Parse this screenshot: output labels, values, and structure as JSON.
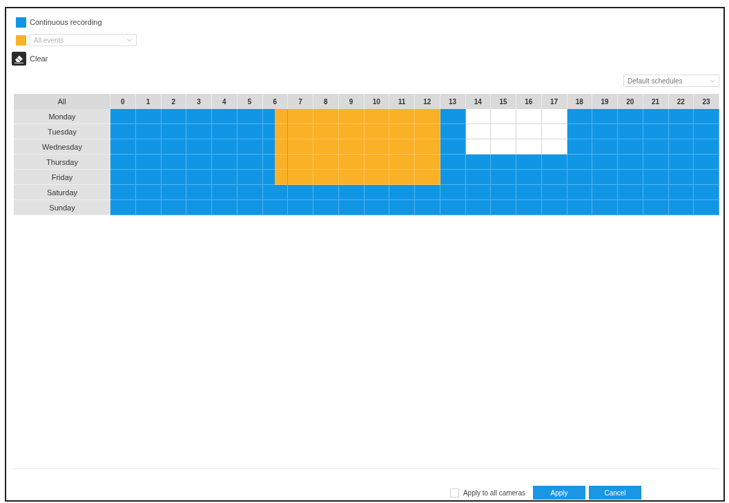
{
  "legend": [
    {
      "kind": "continuous",
      "label": "Continuous recording",
      "color": "#1196e6"
    },
    {
      "kind": "event",
      "color": "#fbb126",
      "dropdown": {
        "value": "All events",
        "disabled": true
      }
    }
  ],
  "clear_button": {
    "label": "Clear"
  },
  "schedule_select": {
    "value": "Default schedules"
  },
  "schedule": {
    "corner": "All",
    "hours": [
      "0",
      "1",
      "2",
      "3",
      "4",
      "5",
      "6",
      "7",
      "8",
      "9",
      "10",
      "11",
      "12",
      "13",
      "14",
      "15",
      "16",
      "17",
      "18",
      "19",
      "20",
      "21",
      "22",
      "23"
    ],
    "rows": [
      {
        "day": "Monday",
        "slots": [
          {
            "kind": "continuous"
          },
          {
            "kind": "continuous"
          },
          {
            "kind": "continuous"
          },
          {
            "kind": "continuous"
          },
          {
            "kind": "continuous"
          },
          {
            "kind": "continuous"
          },
          {
            "kind": "continuous"
          },
          {
            "kind": "continuous"
          },
          {
            "kind": "continuous"
          },
          {
            "kind": "continuous"
          },
          {
            "kind": "continuous"
          },
          {
            "kind": "continuous"
          },
          {
            "kind": "continuous"
          },
          {
            "kind": "event"
          },
          {
            "kind": "event"
          },
          {
            "kind": "event"
          },
          {
            "kind": "event"
          },
          {
            "kind": "event"
          },
          {
            "kind": "event"
          },
          {
            "kind": "event"
          },
          {
            "kind": "event"
          },
          {
            "kind": "event"
          },
          {
            "kind": "event"
          },
          {
            "kind": "event"
          },
          {
            "kind": "event"
          },
          {
            "kind": "event"
          },
          {
            "kind": "continuous"
          },
          {
            "kind": "continuous"
          },
          {
            "kind": "off"
          },
          {
            "kind": "off"
          },
          {
            "kind": "off"
          },
          {
            "kind": "off"
          },
          {
            "kind": "off"
          },
          {
            "kind": "off"
          },
          {
            "kind": "off"
          },
          {
            "kind": "off"
          },
          {
            "kind": "continuous"
          },
          {
            "kind": "continuous"
          },
          {
            "kind": "continuous"
          },
          {
            "kind": "continuous"
          },
          {
            "kind": "continuous"
          },
          {
            "kind": "continuous"
          },
          {
            "kind": "continuous"
          },
          {
            "kind": "continuous"
          },
          {
            "kind": "continuous"
          },
          {
            "kind": "continuous"
          },
          {
            "kind": "continuous"
          },
          {
            "kind": "continuous"
          }
        ]
      },
      {
        "day": "Tuesday",
        "slots": [
          {
            "kind": "continuous"
          },
          {
            "kind": "continuous"
          },
          {
            "kind": "continuous"
          },
          {
            "kind": "continuous"
          },
          {
            "kind": "continuous"
          },
          {
            "kind": "continuous"
          },
          {
            "kind": "continuous"
          },
          {
            "kind": "continuous"
          },
          {
            "kind": "continuous"
          },
          {
            "kind": "continuous"
          },
          {
            "kind": "continuous"
          },
          {
            "kind": "continuous"
          },
          {
            "kind": "continuous"
          },
          {
            "kind": "event"
          },
          {
            "kind": "event"
          },
          {
            "kind": "event"
          },
          {
            "kind": "event"
          },
          {
            "kind": "event"
          },
          {
            "kind": "event"
          },
          {
            "kind": "event"
          },
          {
            "kind": "event"
          },
          {
            "kind": "event"
          },
          {
            "kind": "event"
          },
          {
            "kind": "event"
          },
          {
            "kind": "event"
          },
          {
            "kind": "event"
          },
          {
            "kind": "continuous"
          },
          {
            "kind": "continuous"
          },
          {
            "kind": "off"
          },
          {
            "kind": "off"
          },
          {
            "kind": "off"
          },
          {
            "kind": "off"
          },
          {
            "kind": "off"
          },
          {
            "kind": "off"
          },
          {
            "kind": "off"
          },
          {
            "kind": "off"
          },
          {
            "kind": "continuous"
          },
          {
            "kind": "continuous"
          },
          {
            "kind": "continuous"
          },
          {
            "kind": "continuous"
          },
          {
            "kind": "continuous"
          },
          {
            "kind": "continuous"
          },
          {
            "kind": "continuous"
          },
          {
            "kind": "continuous"
          },
          {
            "kind": "continuous"
          },
          {
            "kind": "continuous"
          },
          {
            "kind": "continuous"
          },
          {
            "kind": "continuous"
          }
        ]
      },
      {
        "day": "Wednesday",
        "slots": [
          {
            "kind": "continuous"
          },
          {
            "kind": "continuous"
          },
          {
            "kind": "continuous"
          },
          {
            "kind": "continuous"
          },
          {
            "kind": "continuous"
          },
          {
            "kind": "continuous"
          },
          {
            "kind": "continuous"
          },
          {
            "kind": "continuous"
          },
          {
            "kind": "continuous"
          },
          {
            "kind": "continuous"
          },
          {
            "kind": "continuous"
          },
          {
            "kind": "continuous"
          },
          {
            "kind": "continuous"
          },
          {
            "kind": "event"
          },
          {
            "kind": "event"
          },
          {
            "kind": "event"
          },
          {
            "kind": "event"
          },
          {
            "kind": "event"
          },
          {
            "kind": "event"
          },
          {
            "kind": "event"
          },
          {
            "kind": "event"
          },
          {
            "kind": "event"
          },
          {
            "kind": "event"
          },
          {
            "kind": "event"
          },
          {
            "kind": "event"
          },
          {
            "kind": "event"
          },
          {
            "kind": "continuous"
          },
          {
            "kind": "continuous"
          },
          {
            "kind": "off"
          },
          {
            "kind": "off"
          },
          {
            "kind": "off"
          },
          {
            "kind": "off"
          },
          {
            "kind": "off"
          },
          {
            "kind": "off"
          },
          {
            "kind": "off"
          },
          {
            "kind": "off"
          },
          {
            "kind": "continuous"
          },
          {
            "kind": "continuous"
          },
          {
            "kind": "continuous"
          },
          {
            "kind": "continuous"
          },
          {
            "kind": "continuous"
          },
          {
            "kind": "continuous"
          },
          {
            "kind": "continuous"
          },
          {
            "kind": "continuous"
          },
          {
            "kind": "continuous"
          },
          {
            "kind": "continuous"
          },
          {
            "kind": "continuous"
          },
          {
            "kind": "continuous"
          }
        ]
      },
      {
        "day": "Thursday",
        "slots": [
          {
            "kind": "continuous"
          },
          {
            "kind": "continuous"
          },
          {
            "kind": "continuous"
          },
          {
            "kind": "continuous"
          },
          {
            "kind": "continuous"
          },
          {
            "kind": "continuous"
          },
          {
            "kind": "continuous"
          },
          {
            "kind": "continuous"
          },
          {
            "kind": "continuous"
          },
          {
            "kind": "continuous"
          },
          {
            "kind": "continuous"
          },
          {
            "kind": "continuous"
          },
          {
            "kind": "continuous"
          },
          {
            "kind": "event"
          },
          {
            "kind": "event"
          },
          {
            "kind": "event"
          },
          {
            "kind": "event"
          },
          {
            "kind": "event"
          },
          {
            "kind": "event"
          },
          {
            "kind": "event"
          },
          {
            "kind": "event"
          },
          {
            "kind": "event"
          },
          {
            "kind": "event"
          },
          {
            "kind": "event"
          },
          {
            "kind": "event"
          },
          {
            "kind": "event"
          },
          {
            "kind": "continuous"
          },
          {
            "kind": "continuous"
          },
          {
            "kind": "continuous"
          },
          {
            "kind": "continuous"
          },
          {
            "kind": "continuous"
          },
          {
            "kind": "continuous"
          },
          {
            "kind": "continuous"
          },
          {
            "kind": "continuous"
          },
          {
            "kind": "continuous"
          },
          {
            "kind": "continuous"
          },
          {
            "kind": "continuous"
          },
          {
            "kind": "continuous"
          },
          {
            "kind": "continuous"
          },
          {
            "kind": "continuous"
          },
          {
            "kind": "continuous"
          },
          {
            "kind": "continuous"
          },
          {
            "kind": "continuous"
          },
          {
            "kind": "continuous"
          },
          {
            "kind": "continuous"
          },
          {
            "kind": "continuous"
          },
          {
            "kind": "continuous"
          },
          {
            "kind": "continuous"
          }
        ]
      },
      {
        "day": "Friday",
        "slots": [
          {
            "kind": "continuous"
          },
          {
            "kind": "continuous"
          },
          {
            "kind": "continuous"
          },
          {
            "kind": "continuous"
          },
          {
            "kind": "continuous"
          },
          {
            "kind": "continuous"
          },
          {
            "kind": "continuous"
          },
          {
            "kind": "continuous"
          },
          {
            "kind": "continuous"
          },
          {
            "kind": "continuous"
          },
          {
            "kind": "continuous"
          },
          {
            "kind": "continuous"
          },
          {
            "kind": "continuous"
          },
          {
            "kind": "event"
          },
          {
            "kind": "event"
          },
          {
            "kind": "event"
          },
          {
            "kind": "event"
          },
          {
            "kind": "event"
          },
          {
            "kind": "event"
          },
          {
            "kind": "event"
          },
          {
            "kind": "event"
          },
          {
            "kind": "event"
          },
          {
            "kind": "event"
          },
          {
            "kind": "event"
          },
          {
            "kind": "event"
          },
          {
            "kind": "event"
          },
          {
            "kind": "continuous"
          },
          {
            "kind": "continuous"
          },
          {
            "kind": "continuous"
          },
          {
            "kind": "continuous"
          },
          {
            "kind": "continuous"
          },
          {
            "kind": "continuous"
          },
          {
            "kind": "continuous"
          },
          {
            "kind": "continuous"
          },
          {
            "kind": "continuous"
          },
          {
            "kind": "continuous"
          },
          {
            "kind": "continuous"
          },
          {
            "kind": "continuous"
          },
          {
            "kind": "continuous"
          },
          {
            "kind": "continuous"
          },
          {
            "kind": "continuous"
          },
          {
            "kind": "continuous"
          },
          {
            "kind": "continuous"
          },
          {
            "kind": "continuous"
          },
          {
            "kind": "continuous"
          },
          {
            "kind": "continuous"
          },
          {
            "kind": "continuous"
          },
          {
            "kind": "continuous"
          }
        ]
      },
      {
        "day": "Saturday",
        "slots": [
          {
            "kind": "continuous"
          },
          {
            "kind": "continuous"
          },
          {
            "kind": "continuous"
          },
          {
            "kind": "continuous"
          },
          {
            "kind": "continuous"
          },
          {
            "kind": "continuous"
          },
          {
            "kind": "continuous"
          },
          {
            "kind": "continuous"
          },
          {
            "kind": "continuous"
          },
          {
            "kind": "continuous"
          },
          {
            "kind": "continuous"
          },
          {
            "kind": "continuous"
          },
          {
            "kind": "continuous"
          },
          {
            "kind": "continuous"
          },
          {
            "kind": "continuous"
          },
          {
            "kind": "continuous"
          },
          {
            "kind": "continuous"
          },
          {
            "kind": "continuous"
          },
          {
            "kind": "continuous"
          },
          {
            "kind": "continuous"
          },
          {
            "kind": "continuous"
          },
          {
            "kind": "continuous"
          },
          {
            "kind": "continuous"
          },
          {
            "kind": "continuous"
          },
          {
            "kind": "continuous"
          },
          {
            "kind": "continuous"
          },
          {
            "kind": "continuous"
          },
          {
            "kind": "continuous"
          },
          {
            "kind": "continuous"
          },
          {
            "kind": "continuous"
          },
          {
            "kind": "continuous"
          },
          {
            "kind": "continuous"
          },
          {
            "kind": "continuous"
          },
          {
            "kind": "continuous"
          },
          {
            "kind": "continuous"
          },
          {
            "kind": "continuous"
          },
          {
            "kind": "continuous"
          },
          {
            "kind": "continuous"
          },
          {
            "kind": "continuous"
          },
          {
            "kind": "continuous"
          },
          {
            "kind": "continuous"
          },
          {
            "kind": "continuous"
          },
          {
            "kind": "continuous"
          },
          {
            "kind": "continuous"
          },
          {
            "kind": "continuous"
          },
          {
            "kind": "continuous"
          },
          {
            "kind": "continuous"
          },
          {
            "kind": "continuous"
          }
        ]
      },
      {
        "day": "Sunday",
        "slots": [
          {
            "kind": "continuous"
          },
          {
            "kind": "continuous"
          },
          {
            "kind": "continuous"
          },
          {
            "kind": "continuous"
          },
          {
            "kind": "continuous"
          },
          {
            "kind": "continuous"
          },
          {
            "kind": "continuous"
          },
          {
            "kind": "continuous"
          },
          {
            "kind": "continuous"
          },
          {
            "kind": "continuous"
          },
          {
            "kind": "continuous"
          },
          {
            "kind": "continuous"
          },
          {
            "kind": "continuous"
          },
          {
            "kind": "continuous"
          },
          {
            "kind": "continuous"
          },
          {
            "kind": "continuous"
          },
          {
            "kind": "continuous"
          },
          {
            "kind": "continuous"
          },
          {
            "kind": "continuous"
          },
          {
            "kind": "continuous"
          },
          {
            "kind": "continuous"
          },
          {
            "kind": "continuous"
          },
          {
            "kind": "continuous"
          },
          {
            "kind": "continuous"
          },
          {
            "kind": "continuous"
          },
          {
            "kind": "continuous"
          },
          {
            "kind": "continuous"
          },
          {
            "kind": "continuous"
          },
          {
            "kind": "continuous"
          },
          {
            "kind": "continuous"
          },
          {
            "kind": "continuous"
          },
          {
            "kind": "continuous"
          },
          {
            "kind": "continuous"
          },
          {
            "kind": "continuous"
          },
          {
            "kind": "continuous"
          },
          {
            "kind": "continuous"
          },
          {
            "kind": "continuous"
          },
          {
            "kind": "continuous"
          },
          {
            "kind": "continuous"
          },
          {
            "kind": "continuous"
          },
          {
            "kind": "continuous"
          },
          {
            "kind": "continuous"
          },
          {
            "kind": "continuous"
          },
          {
            "kind": "continuous"
          },
          {
            "kind": "continuous"
          },
          {
            "kind": "continuous"
          },
          {
            "kind": "continuous"
          },
          {
            "kind": "continuous"
          }
        ]
      }
    ]
  },
  "apply_all": {
    "label": "Apply to all cameras",
    "checked": false
  },
  "buttons": [
    "Apply",
    "Cancel"
  ]
}
